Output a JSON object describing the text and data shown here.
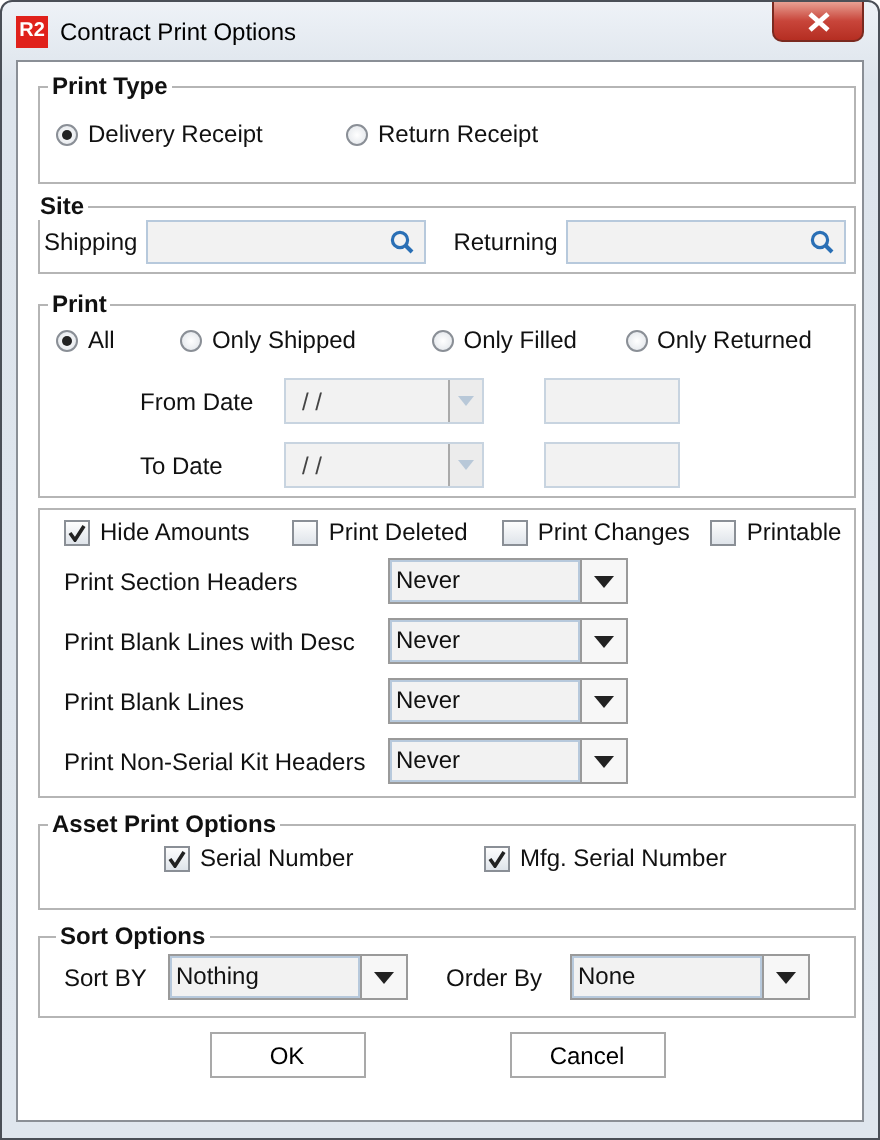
{
  "window": {
    "logo_text": "R2",
    "title": "Contract Print Options"
  },
  "print_type": {
    "title": "Print Type",
    "options": [
      {
        "label": "Delivery Receipt",
        "selected": true
      },
      {
        "label": "Return Receipt",
        "selected": false
      }
    ]
  },
  "site": {
    "title": "Site",
    "fields": [
      {
        "label": "Shipping"
      },
      {
        "label": "Returning"
      }
    ]
  },
  "print": {
    "title": "Print",
    "options": [
      {
        "label": "All",
        "selected": true
      },
      {
        "label": "Only Shipped",
        "selected": false
      },
      {
        "label": "Only Filled",
        "selected": false
      },
      {
        "label": "Only Returned",
        "selected": false
      }
    ],
    "dates": [
      {
        "label": "From Date",
        "value": "/ /",
        "disabled": true
      },
      {
        "label": "To Date",
        "value": "/ /",
        "disabled": true
      }
    ]
  },
  "flags": [
    {
      "label": "Hide Amounts",
      "checked": true
    },
    {
      "label": "Print Deleted",
      "checked": false
    },
    {
      "label": "Print Changes",
      "checked": false
    },
    {
      "label": "Printable",
      "checked": false
    }
  ],
  "print_settings": [
    {
      "label": "Print Section Headers",
      "value": "Never"
    },
    {
      "label": "Print Blank Lines with Desc",
      "value": "Never"
    },
    {
      "label": "Print Blank Lines",
      "value": "Never"
    },
    {
      "label": "Print Non-Serial Kit Headers",
      "value": "Never"
    }
  ],
  "asset_print_options": {
    "title": "Asset Print Options",
    "options": [
      {
        "label": "Serial Number",
        "checked": true
      },
      {
        "label": "Mfg. Serial Number",
        "checked": true
      }
    ]
  },
  "sort_options": {
    "title": "Sort Options",
    "fields": [
      {
        "label": "Sort BY",
        "value": "Nothing"
      },
      {
        "label": "Order By",
        "value": "None"
      }
    ]
  },
  "buttons": [
    "OK",
    "Cancel"
  ]
}
